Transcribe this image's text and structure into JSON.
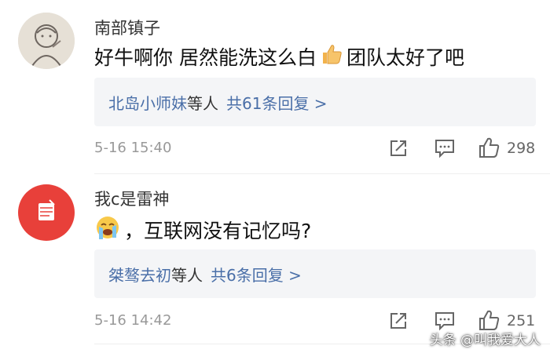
{
  "comments": [
    {
      "username": "南部镇子",
      "text_before": "好牛啊你 居然能洗这么白",
      "emoji_name": "thumbs-up-icon",
      "text_after": "团队太好了吧",
      "reply_names": "北岛小师妹",
      "reply_mid": "等人",
      "reply_count_text": "共61条回复 >",
      "timestamp": "5-16 15:40",
      "likes": "298"
    },
    {
      "username": "我c是雷神",
      "emoji_name": "crying-face-icon",
      "text_after": "，互联网没有记忆吗?",
      "reply_names": "桀骜去初",
      "reply_mid": "等人",
      "reply_count_text": "共6条回复 >",
      "timestamp": "5-16 14:42",
      "likes": "251"
    }
  ],
  "watermark": "头条 @叫我爱大人",
  "colors": {
    "link": "#4a6fa8",
    "reply_bg": "#f4f5f7",
    "avatar2": "#e8403a",
    "timestamp": "#999999"
  }
}
